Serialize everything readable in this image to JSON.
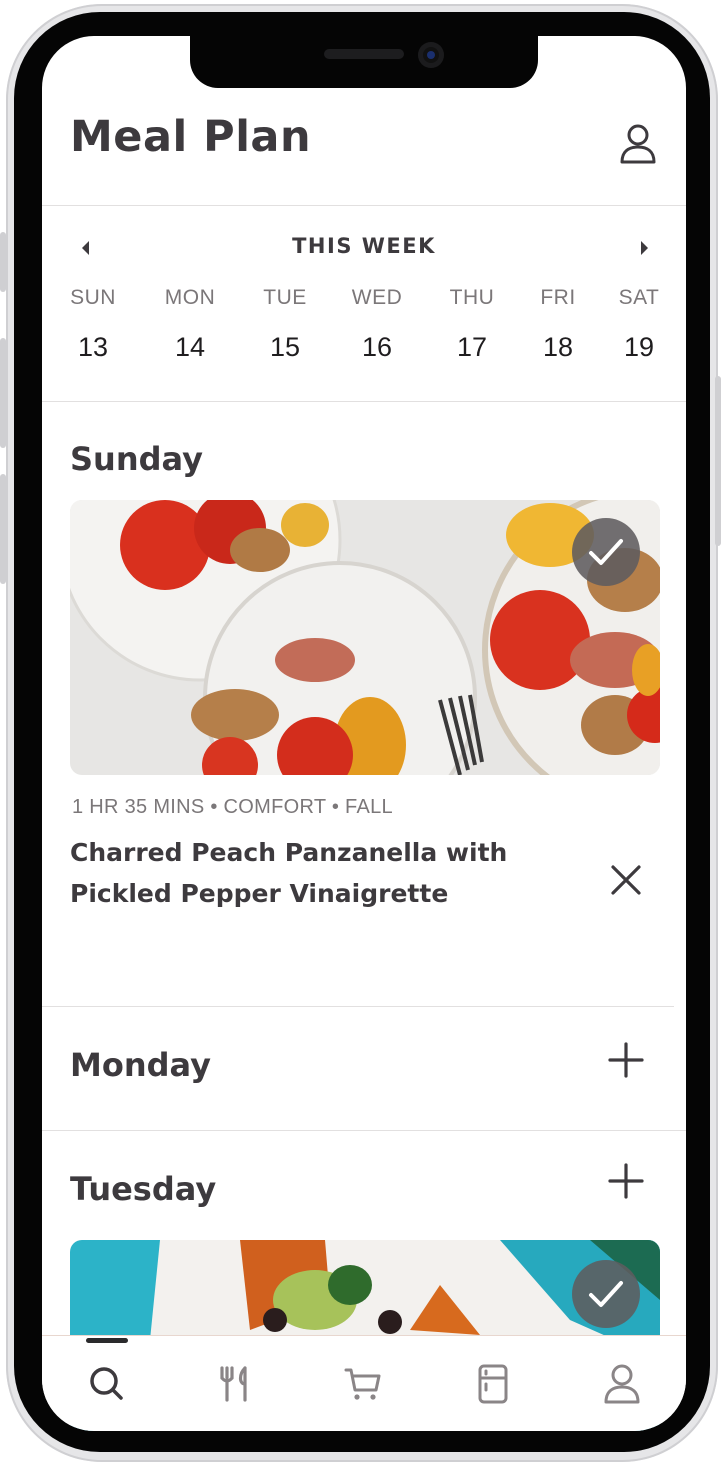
{
  "header": {
    "title": "Meal Plan"
  },
  "week": {
    "label": "THIS WEEK",
    "days": [
      {
        "name": "SUN",
        "num": "13"
      },
      {
        "name": "MON",
        "num": "14"
      },
      {
        "name": "TUE",
        "num": "15"
      },
      {
        "name": "WED",
        "num": "16"
      },
      {
        "name": "THU",
        "num": "17"
      },
      {
        "name": "FRI",
        "num": "18"
      },
      {
        "name": "SAT",
        "num": "19"
      }
    ]
  },
  "sections": [
    {
      "day": "Sunday",
      "recipe": {
        "meta": "1 HR 35 MINS • COMFORT  • FALL",
        "title": "Charred Peach Panzanella with Pickled Pepper Vinaigrette"
      }
    },
    {
      "day": "Monday"
    },
    {
      "day": "Tuesday"
    }
  ],
  "icons": {
    "profile": "profile-icon",
    "prev": "chevron-left-icon",
    "next": "chevron-right-icon",
    "check": "checkmark-icon",
    "remove": "close-icon",
    "add": "plus-icon",
    "tabs": [
      "search-icon",
      "utensils-icon",
      "cart-icon",
      "fridge-icon",
      "profile-icon"
    ]
  },
  "colors": {
    "text": "#3d3a3e",
    "muted": "#7b7779",
    "divider": "#e2e0e0"
  }
}
